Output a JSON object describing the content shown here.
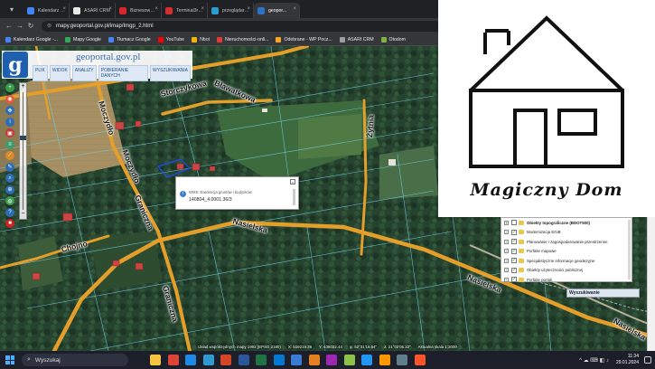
{
  "tabs": [
    {
      "title": "Kalendarz Google - T...",
      "color": "#4285f4",
      "active": false
    },
    {
      "title": "ASARI CRM",
      "color": "#e8e8e8",
      "active": false
    },
    {
      "title": "Biznesowa poczta em...",
      "color": "#d7262c",
      "active": false
    },
    {
      "title": "Terminal3r 3 Bur4 mu...",
      "color": "#d32f2f",
      "active": false
    },
    {
      "title": "przeglądarka-ekw.ms...",
      "color": "#2d9ad1",
      "active": false
    },
    {
      "title": "geopor...",
      "color": "#2d72c4",
      "active": true
    }
  ],
  "address": {
    "url": "mapy.geoportal.gov.pl/imap/Imgp_2.html"
  },
  "bookmarks": [
    {
      "label": "Kalendarz Google -...",
      "color": "#4285f4"
    },
    {
      "label": "Mapy Google",
      "color": "#34a853"
    },
    {
      "label": "Tłumacz Google",
      "color": "#4285f4"
    },
    {
      "label": "YouTube",
      "color": "#ff0000"
    },
    {
      "label": "Nbot",
      "color": "#f4b400"
    },
    {
      "label": "Nieruchomości-onli...",
      "color": "#e53935"
    },
    {
      "label": "Odebrane - WP Pocz...",
      "color": "#f9a825"
    },
    {
      "label": "ASARI CRM",
      "color": "#9e9e9e"
    },
    {
      "label": "Otodom",
      "color": "#7cb342"
    }
  ],
  "geoportal": {
    "logo_letter": "g",
    "title": "geoportal.gov.pl",
    "menu": [
      "PLIK",
      "WIDOK",
      "ANALIZY",
      "POBIERANIE DANYCH",
      "WYSZUKIWANIA"
    ]
  },
  "tools": [
    {
      "name": "zoom-in-tool-icon",
      "color": "#3b9b4b"
    },
    {
      "name": "select-tool-icon",
      "color": "#e05a3a"
    },
    {
      "name": "pan-tool-icon",
      "color": "#2f6db3"
    },
    {
      "name": "info-tool-icon",
      "color": "#2f6db3"
    },
    {
      "name": "print-tool-icon",
      "color": "#c23b3b"
    },
    {
      "name": "layers-tool-icon",
      "color": "#3f9b6b"
    },
    {
      "name": "measure-tool-icon",
      "color": "#d98b2b"
    },
    {
      "name": "edit-tool-icon",
      "color": "#2f6db3"
    },
    {
      "name": "search-tool-icon",
      "color": "#2f6db3"
    },
    {
      "name": "zoom-tool-icon",
      "color": "#2f6db3"
    },
    {
      "name": "globe-tool-icon",
      "color": "#3b9b4b"
    },
    {
      "name": "help-tool-icon",
      "color": "#2f6db3"
    },
    {
      "name": "stop-tool-icon",
      "color": "#cc2222"
    }
  ],
  "streets": {
    "bialotkowa": "Bławatkowa",
    "storczykowa": "Storczykowa",
    "moczydlo1": "Moczydło",
    "moczydlo2": "Moczydło",
    "graniczna1": "Graniczna",
    "graniczna2": "Graniczna",
    "zytnia": "Żytnia",
    "nasielska1": "Nasielska",
    "nasielska2": "Nasielska",
    "nasielska3": "Nasielska",
    "chojno": "Chojno"
  },
  "popup": {
    "header": "WMS: Ewidencja gruntów i budynków",
    "parcel": "140804_4.0001.36/3"
  },
  "layers": [
    {
      "label": "Obiekty topograficzne (BDOT500)",
      "bold": true,
      "checked": false
    },
    {
      "label": "Modernizacja EGiB",
      "bold": false,
      "checked": true
    },
    {
      "label": "Planowanie i zagospodarowanie przestrzenne",
      "bold": false,
      "checked": true
    },
    {
      "label": "Porfalie mapowe",
      "bold": false,
      "checked": true
    },
    {
      "label": "Specjalistyczne informacje geodezyjne",
      "bold": false,
      "checked": true
    },
    {
      "label": "Obiekty użyteczności publicznej",
      "bold": false,
      "checked": true
    },
    {
      "label": "Porfalie portali",
      "bold": false,
      "checked": true
    }
  ],
  "search_panel": {
    "label": "Wyszukiwanie"
  },
  "status": {
    "coord_system": "Układ współrzędnych mapy 1992 (EPSG 2180)",
    "x": "X: 519219.39",
    "y": "Y: 638032.44",
    "lat": "φ: 52°31'16.64\"",
    "lon": "λ: 21°02'06.22\"",
    "scale": "Aktualna skala 1:2000"
  },
  "watermark": {
    "text": "Magiczny Dom"
  },
  "taskbar": {
    "search_placeholder": "Wyszukaj",
    "time": "11:34",
    "date": "29.01.2024",
    "apps": [
      {
        "name": "file-explorer-icon",
        "color": "#f6c443"
      },
      {
        "name": "chrome-icon",
        "color": "#db4437"
      },
      {
        "name": "edge-icon",
        "color": "#1e88e5"
      },
      {
        "name": "store-icon",
        "color": "#2d9ad1"
      },
      {
        "name": "powerpoint-icon",
        "color": "#d24726"
      },
      {
        "name": "word-icon",
        "color": "#2b579a"
      },
      {
        "name": "excel-icon",
        "color": "#217346"
      },
      {
        "name": "outlook-icon",
        "color": "#0078d4"
      },
      {
        "name": "app-icon-1",
        "color": "#3a7bd5"
      },
      {
        "name": "app-icon-2",
        "color": "#e67e22"
      },
      {
        "name": "app-icon-3",
        "color": "#9c27b0"
      },
      {
        "name": "app-icon-4",
        "color": "#8bc34a"
      },
      {
        "name": "app-icon-5",
        "color": "#2196f3"
      },
      {
        "name": "app-icon-6",
        "color": "#ff9800"
      },
      {
        "name": "app-icon-7",
        "color": "#607d8b"
      },
      {
        "name": "brave-icon",
        "color": "#fb542b"
      }
    ]
  }
}
